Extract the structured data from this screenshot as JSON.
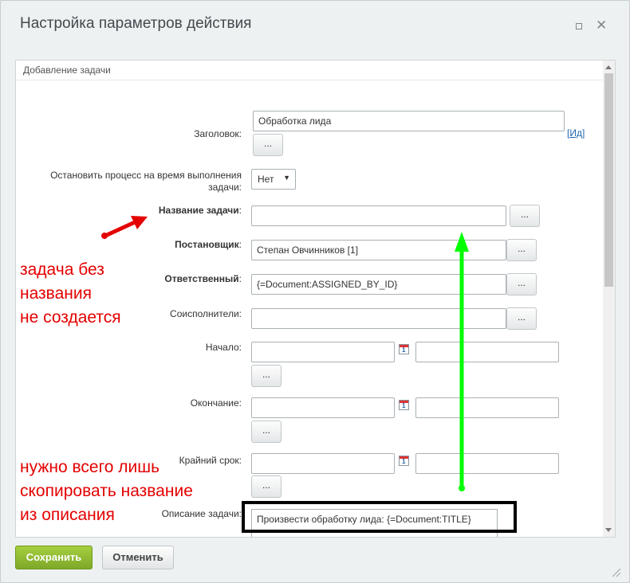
{
  "dialog": {
    "title": "Настройка параметров действия",
    "section_title": "Добавление задачи"
  },
  "fields": {
    "title_label": "Заголовок:",
    "title_value": "Обработка лида",
    "title_link": "Ид",
    "pause_label": "Остановить процесс на время выполнения задачи:",
    "pause_value": "Нет",
    "task_name_label": "Название задачи",
    "task_name_value": "",
    "creator_label": "Постановщик",
    "creator_value": "Степан Овчинников [1]",
    "responsible_label": "Ответственный",
    "responsible_value": "{=Document:ASSIGNED_BY_ID}",
    "accomplices_label": "Соисполнители:",
    "start_label": "Начало:",
    "end_label": "Окончание:",
    "deadline_label": "Крайний срок:",
    "description_label": "Описание задачи:",
    "description_value": "Произвести обработку лида: {=Document:TITLE}",
    "dots": "...",
    "calendar_day": "1"
  },
  "annotations": {
    "no_name_line1": "задача без",
    "no_name_line2": "названия",
    "no_name_line3": "не создается",
    "copy_line1": "нужно всего лишь",
    "copy_line2": "скопировать название",
    "copy_line3": "из описания"
  },
  "footer": {
    "save_label": "Сохранить",
    "cancel_label": "Отменить"
  },
  "colors": {
    "annotation_red": "#e40000",
    "arrow_green": "#00ff00",
    "save_green": "#8cb82f"
  }
}
